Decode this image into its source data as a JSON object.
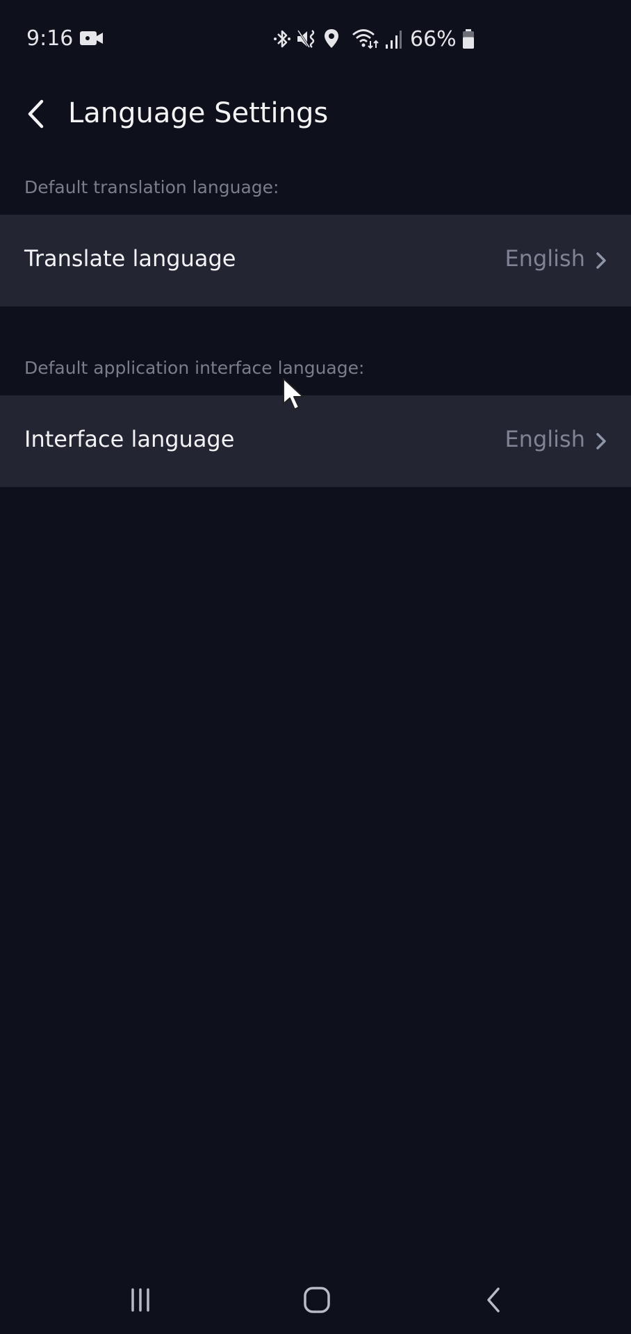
{
  "status_bar": {
    "time": "9:16",
    "left_icons": [
      "video-camera-icon"
    ],
    "right_icons": [
      "bluetooth-icon",
      "mute-vibrate-icon",
      "location-icon",
      "wifi-data-icon",
      "signal-icon"
    ],
    "battery_percent": "66%",
    "battery_level": 0.66
  },
  "header": {
    "back_icon": "chevron-left-icon",
    "title": "Language Settings"
  },
  "sections": [
    {
      "label": "Default translation language:",
      "row": {
        "label": "Translate language",
        "value": "English",
        "icon": "chevron-right-icon"
      }
    },
    {
      "label": "Default application interface language:",
      "row": {
        "label": "Interface language",
        "value": "English",
        "icon": "chevron-right-icon"
      }
    }
  ],
  "nav_bar": {
    "recents_icon": "recent-apps-icon",
    "home_icon": "home-icon",
    "back_icon": "back-icon"
  },
  "colors": {
    "background": "#0e101c",
    "row_background": "#232533",
    "section_label": "#7b7e8a",
    "value_text": "#7f8394",
    "chevron": "#9096aa"
  }
}
